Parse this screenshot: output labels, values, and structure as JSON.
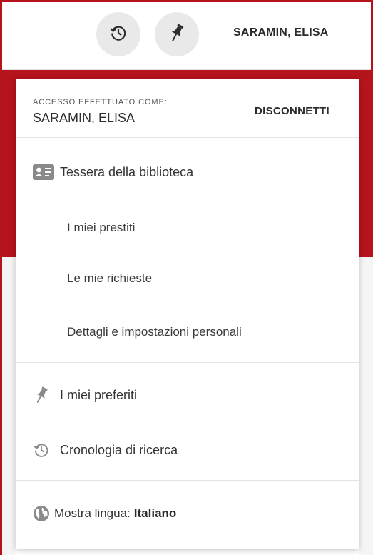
{
  "header": {
    "history_icon": "history-icon",
    "pin_icon": "pin-icon",
    "user_name": "SARAMIN, ELISA"
  },
  "account": {
    "signed_in_label": "ACCESSO EFFETTUATO COME:",
    "user_name": "SARAMIN, ELISA",
    "logout_label": "DISCONNETTI"
  },
  "menu": {
    "library_card": {
      "label": "Tessera della biblioteca",
      "icon": "id-card-icon"
    },
    "subitems": [
      {
        "label": "I miei prestiti"
      },
      {
        "label": "Le mie richieste"
      },
      {
        "label": "Dettagli e impostazioni personali"
      }
    ],
    "favorites": {
      "label": "I miei preferiti",
      "icon": "pin-icon"
    },
    "history": {
      "label": "Cronologia di ricerca",
      "icon": "history-icon"
    },
    "language": {
      "label": "Mostra lingua:",
      "value": "Italiano",
      "icon": "globe-icon"
    }
  },
  "colors": {
    "accent": "#b5141c",
    "icon_gray": "#8a8a8a",
    "button_bg": "#e9e9e9"
  }
}
